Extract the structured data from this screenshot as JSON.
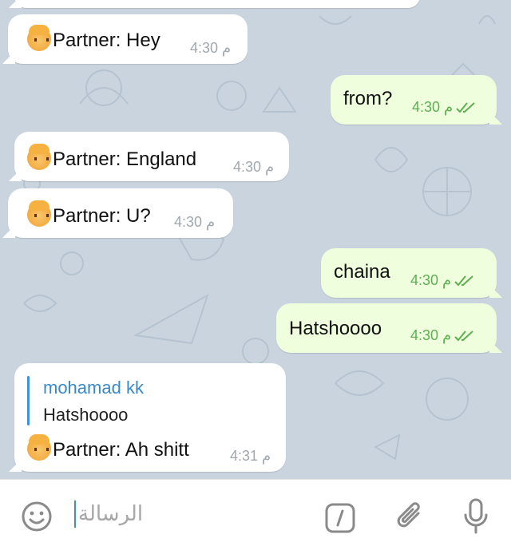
{
  "chat": {
    "messages": [
      {
        "direction": "in",
        "sender": "Partner",
        "text": "Hey",
        "time": "4:30 م"
      },
      {
        "direction": "out",
        "text": "from?",
        "time": "4:30 م",
        "status": "read"
      },
      {
        "direction": "in",
        "sender": "Partner",
        "text": "England",
        "time": "4:30 م"
      },
      {
        "direction": "in",
        "sender": "Partner",
        "text": "U?",
        "time": "4:30 م"
      },
      {
        "direction": "out",
        "text": "chaina",
        "time": "4:30 م",
        "status": "read"
      },
      {
        "direction": "out",
        "text": "Hatshoooo",
        "time": "4:30 م",
        "status": "read"
      },
      {
        "direction": "in",
        "sender": "Partner",
        "text": "Ah shitt",
        "time": "4:31 م",
        "reply": {
          "name": "mohamad kk",
          "text": "Hatshoooo"
        }
      }
    ]
  },
  "composer": {
    "placeholder": "الرسالة",
    "icons": [
      "emoji-icon",
      "bot-commands-icon",
      "attach-icon",
      "microphone-icon"
    ]
  },
  "colors": {
    "chat_background": "#c9d4df",
    "incoming_bubble": "#ffffff",
    "outgoing_bubble": "#effedd",
    "read_ticks": "#5fae53",
    "reply_accent": "#3d95d8"
  }
}
